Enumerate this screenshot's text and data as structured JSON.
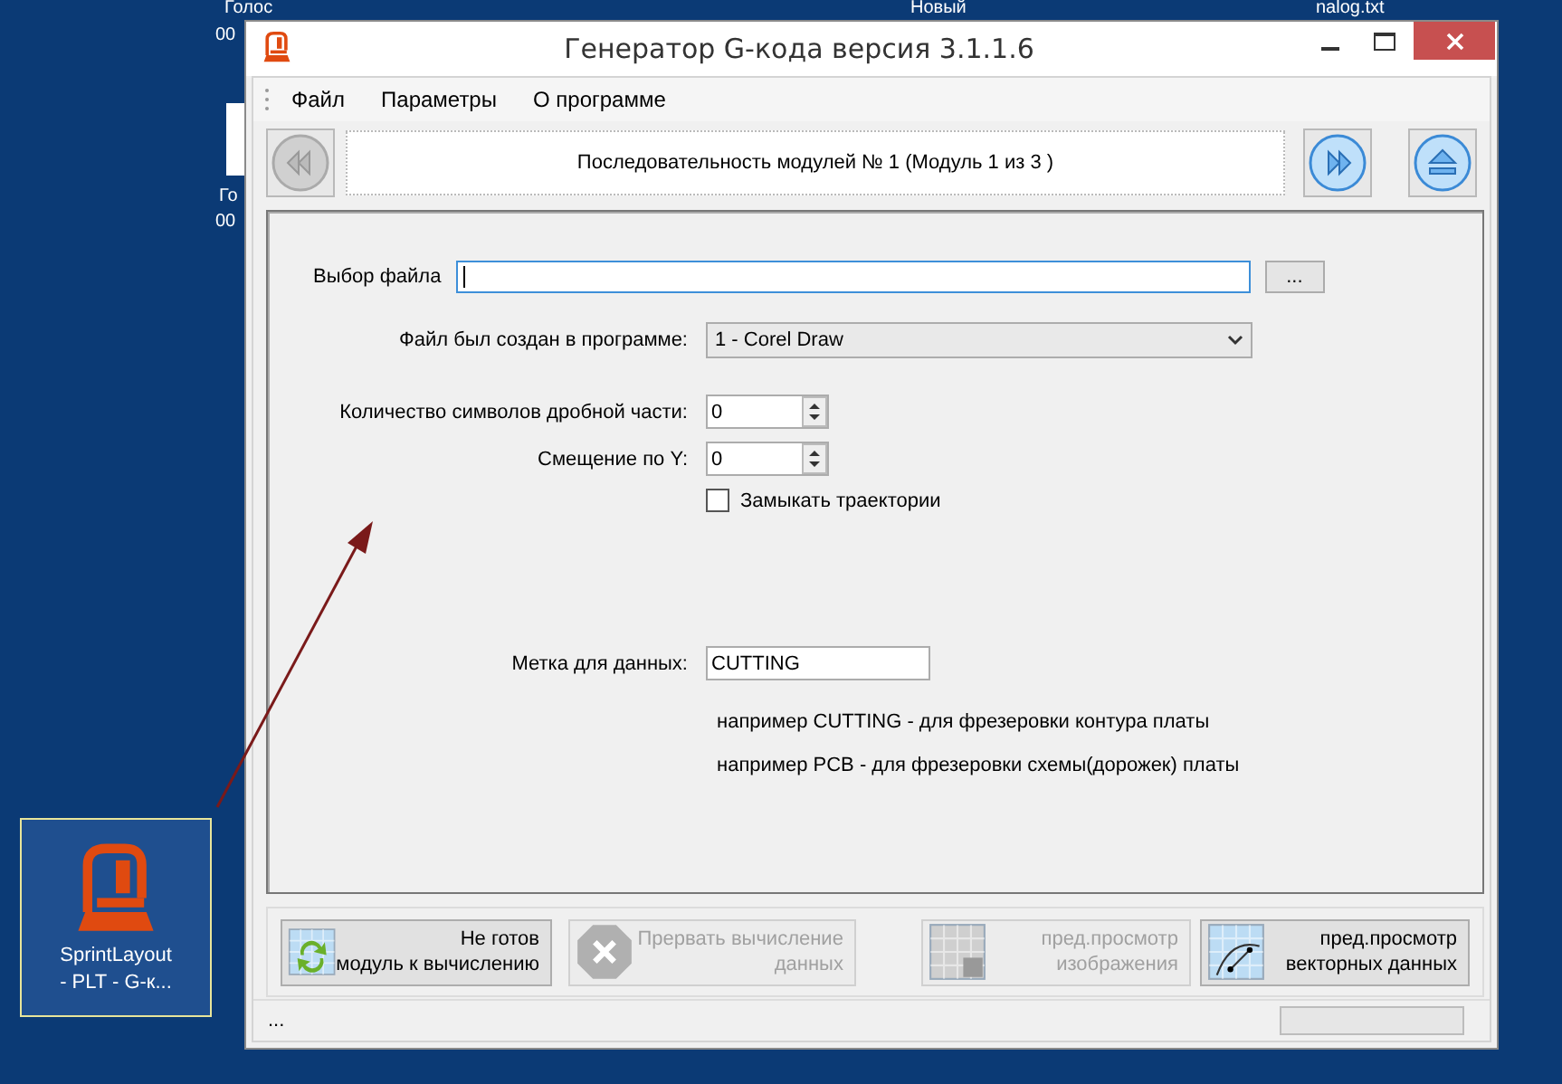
{
  "desktop": {
    "labels": [
      {
        "text": "Голос"
      },
      {
        "text": "00"
      },
      {
        "text": "Новый"
      },
      {
        "text": "nalog.txt"
      },
      {
        "text": "Го"
      },
      {
        "text": "00"
      }
    ],
    "shortcut": {
      "lines": [
        "SprintLayout",
        "- PLT - G-к..."
      ],
      "selected": true
    }
  },
  "window": {
    "title": "Генератор G-кода версия 3.1.1.6"
  },
  "menu": [
    "Файл",
    "Параметры",
    "О программе"
  ],
  "nav": {
    "back_disabled": true,
    "text": "Последовательность модулей № 1 (Модуль 1 из 3 )",
    "forward_disabled": false,
    "eject_disabled": false
  },
  "form": {
    "file_label": "Выбор файла",
    "browse": "...",
    "program_label": "Файл был создан в программе:",
    "program_value": "1 - Corel Draw",
    "spinners": [
      {
        "label": "Количество символов дробной части:",
        "value": "0"
      },
      {
        "label": "Смещение по Y:",
        "value": "0"
      }
    ],
    "close_paths": {
      "label": "Замыкать траектории",
      "checked": false
    },
    "tag_label": "Метка для данных:",
    "tag_value": "CUTTING",
    "hints": [
      "например CUTTING - для фрезеровки контура платы",
      "например PCB - для фрезеровки схемы(дорожек) платы"
    ]
  },
  "actions": [
    {
      "kind": "refresh",
      "lines": [
        "Не готов",
        "модуль к вычислению"
      ],
      "disabled": false
    },
    {
      "kind": "stop",
      "lines": [
        "Прервать вычисление",
        "данных"
      ],
      "disabled": true
    },
    {
      "kind": "image",
      "lines": [
        "пред.просмотр",
        "изображения"
      ],
      "disabled": true
    },
    {
      "kind": "vector",
      "lines": [
        "пред.просмотр",
        "векторных данных"
      ],
      "disabled": false
    }
  ],
  "status_bar": {
    "text": "...",
    "progress": {
      "level": 0
    }
  }
}
